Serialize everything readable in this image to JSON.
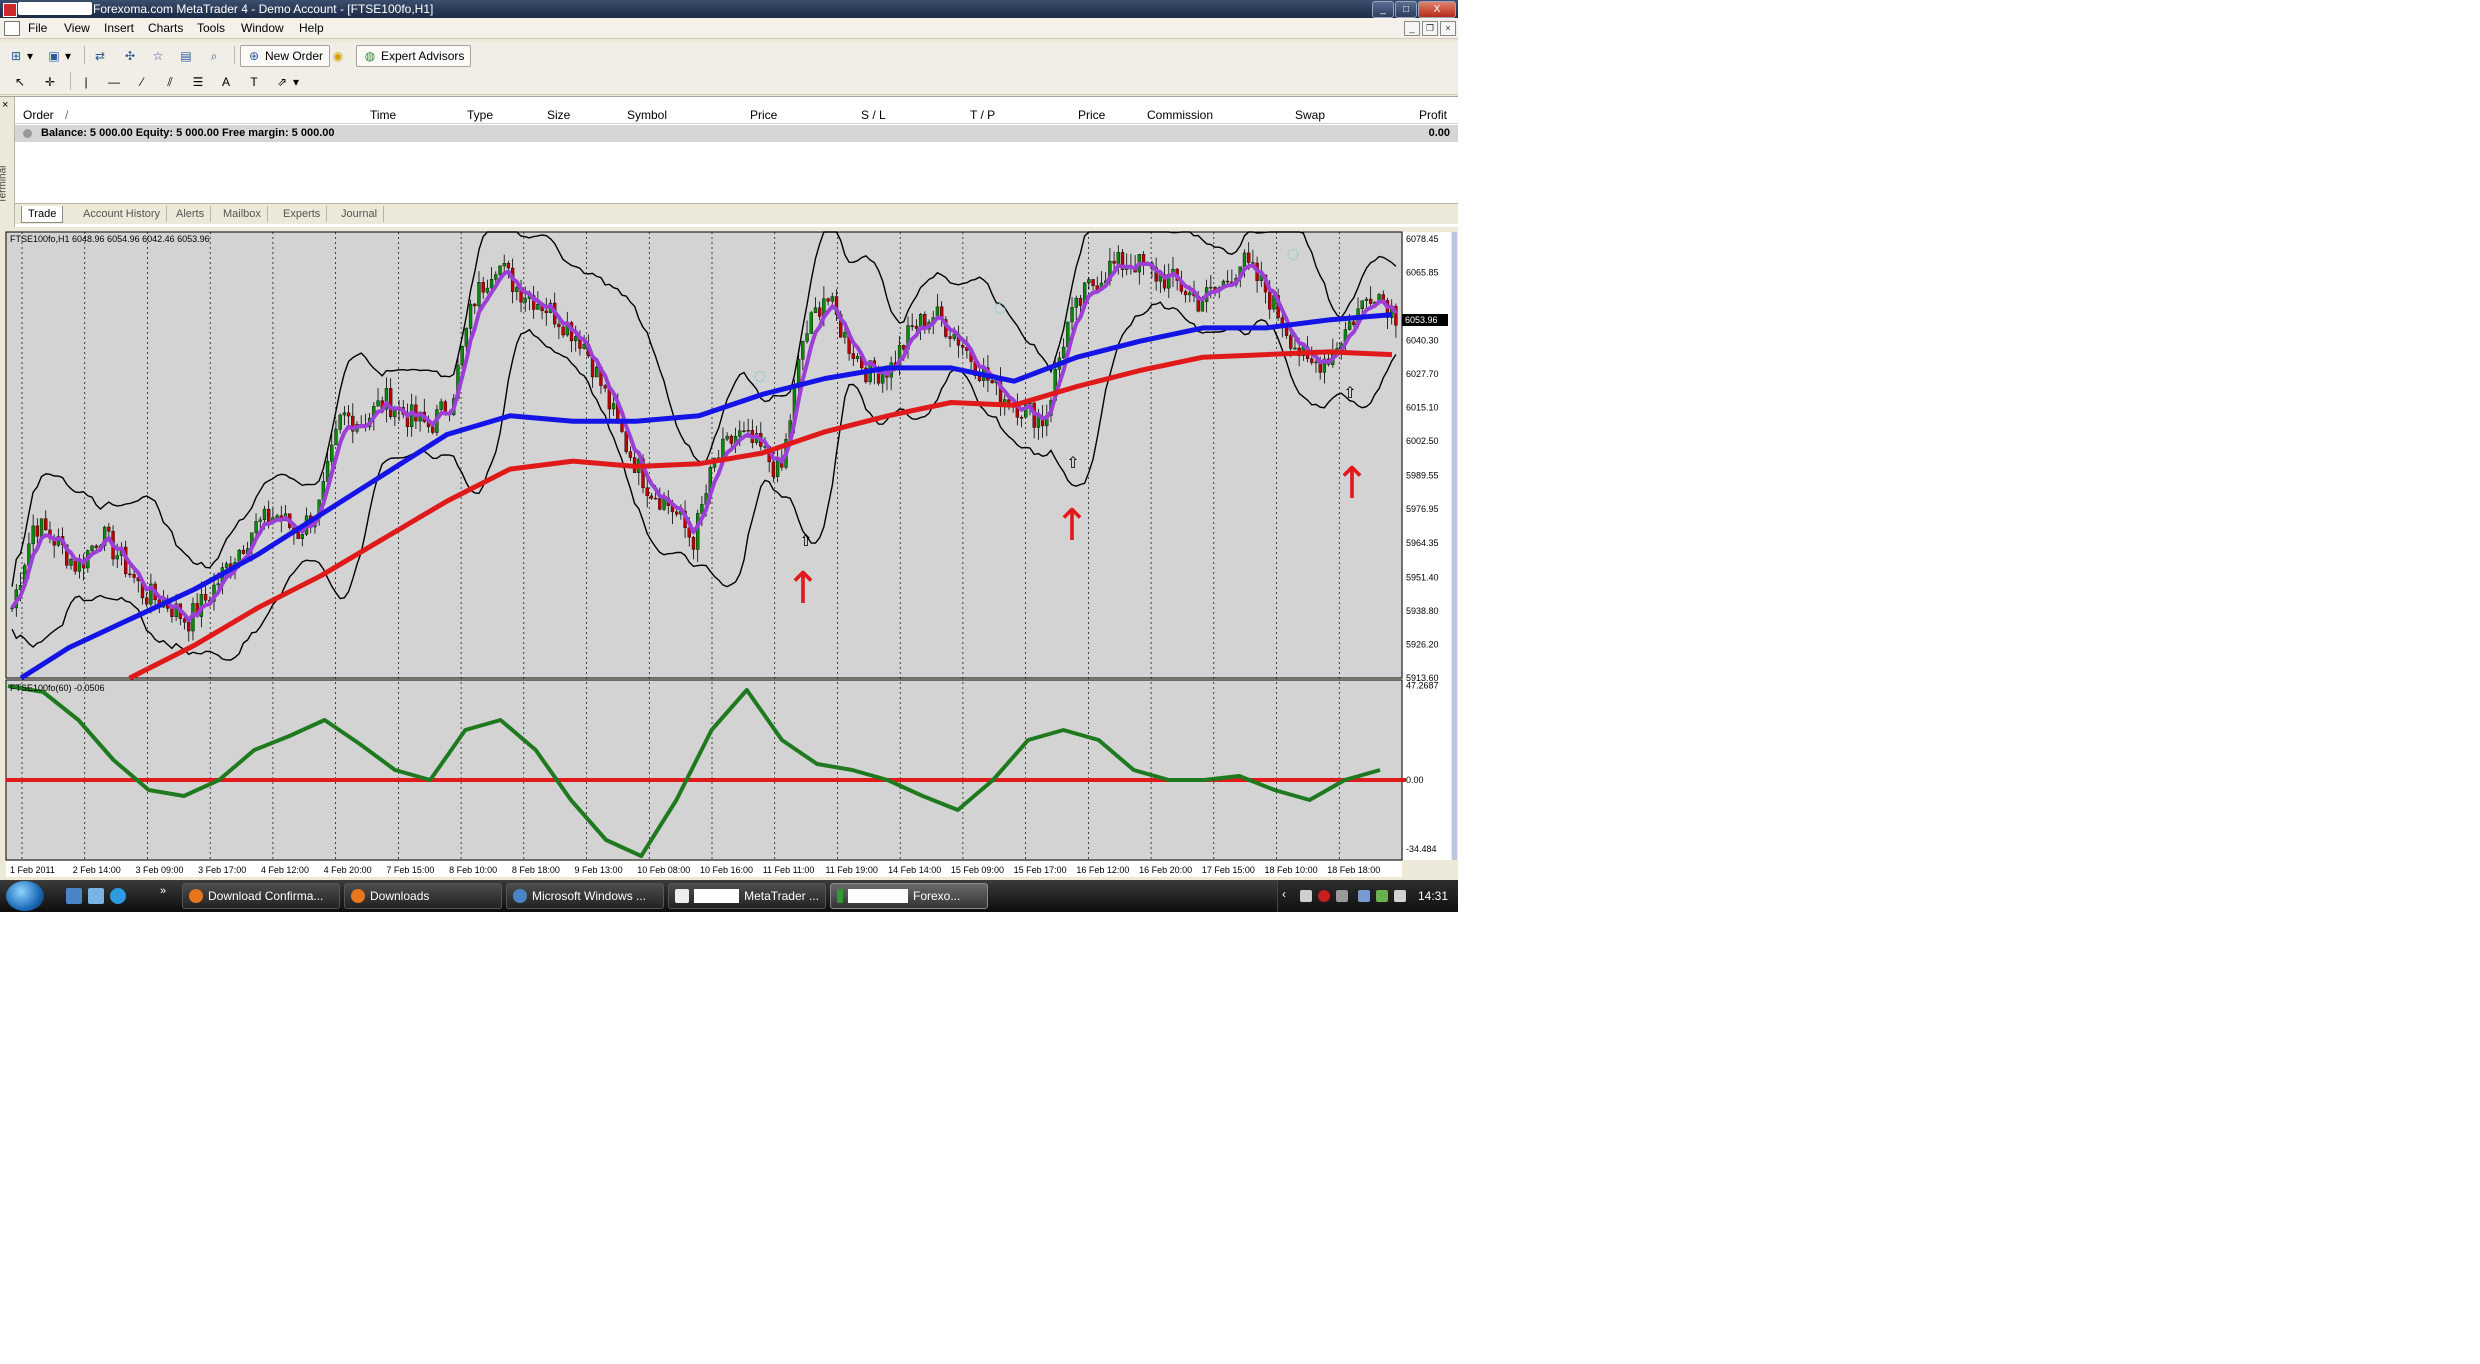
{
  "window": {
    "title": "Forexoma.com MetaTrader 4 - Demo Account - [FTSE100fo,H1]",
    "controls": [
      "_",
      "□",
      "X"
    ]
  },
  "menu": [
    "File",
    "View",
    "Insert",
    "Charts",
    "Tools",
    "Window",
    "Help"
  ],
  "toolbar": {
    "new_order": "New Order",
    "expert_advisors": "Expert Advisors"
  },
  "terminal": {
    "side_label": "Terminal",
    "close": "×",
    "columns": [
      "Order",
      "/",
      "Time",
      "Type",
      "Size",
      "Symbol",
      "Price",
      "S / L",
      "T / P",
      "Price",
      "Commission",
      "Swap",
      "Profit"
    ],
    "balance_row": "Balance: 5 000.00  Equity: 5 000.00  Free margin: 5 000.00",
    "balance_profit": "0.00",
    "tabs": [
      "Trade",
      "Account History",
      "Alerts",
      "Mailbox",
      "Experts",
      "Journal"
    ]
  },
  "chart_data": {
    "type": "candlestick",
    "header": "FTSE100fo,H1  6048.96 6054.96 6042.46 6053.96",
    "current_price": "6053.96",
    "y_ticks": [
      "6078.45",
      "6065.85",
      "6053.96",
      "6040.30",
      "6027.70",
      "6015.10",
      "6002.50",
      "5989.55",
      "5976.95",
      "5964.35",
      "5951.40",
      "5938.80",
      "5926.20",
      "5913.60"
    ],
    "ylim": [
      5913.6,
      6081
    ],
    "x_ticks": [
      "1 Feb 2011",
      "2 Feb 14:00",
      "3 Feb 09:00",
      "3 Feb 17:00",
      "4 Feb 12:00",
      "4 Feb 20:00",
      "7 Feb 15:00",
      "8 Feb 10:00",
      "8 Feb 18:00",
      "9 Feb 13:00",
      "10 Feb 08:00",
      "10 Feb 16:00",
      "11 Feb 11:00",
      "11 Feb 19:00",
      "14 Feb 14:00",
      "15 Feb 09:00",
      "15 Feb 17:00",
      "16 Feb 12:00",
      "16 Feb 20:00",
      "17 Feb 15:00",
      "18 Feb 10:00",
      "18 Feb 18:00"
    ],
    "price_path": [
      5940,
      5972,
      5965,
      5955,
      5968,
      5958,
      5945,
      5942,
      5935,
      5945,
      5958,
      5970,
      5975,
      5968,
      5978,
      6012,
      6010,
      6018,
      6012,
      6008,
      6018,
      6055,
      6070,
      6060,
      6055,
      6048,
      6040,
      6020,
      6000,
      5985,
      5978,
      5965,
      5995,
      6005,
      6000,
      5990,
      6040,
      6058,
      6040,
      6028,
      6030,
      6045,
      6050,
      6042,
      6030,
      6020,
      6015,
      6010,
      6045,
      6060,
      6068,
      6070,
      6065,
      6062,
      6055,
      6060,
      6070,
      6060,
      6045,
      6030,
      6035,
      6048,
      6060,
      6050
    ],
    "series": [
      {
        "name": "",
        "color": "#1414e6",
        "values": [
          5910,
          5925,
          5936,
          5947,
          5960,
          5975,
          5990,
          6005,
          6012,
          6010,
          6010,
          6012,
          6020,
          6026,
          6030,
          6030,
          6025,
          6034,
          6040,
          6045,
          6045,
          6048,
          6050
        ]
      },
      {
        "name": "",
        "color": "#e01a1a",
        "values": [
          5895,
          5904,
          5914,
          5926,
          5940,
          5952,
          5966,
          5980,
          5992,
          5995,
          5993,
          5994,
          5998,
          6006,
          6012,
          6017,
          6016,
          6023,
          6029,
          6034,
          6035,
          6036,
          6035
        ]
      }
    ],
    "indicator": {
      "label": "FTSE100fo(60)  -0.0506",
      "y_ticks": [
        "47.2687",
        "0.00",
        "-34.484"
      ],
      "ylim": [
        -40,
        50
      ],
      "values": [
        47,
        44,
        30,
        10,
        -5,
        -8,
        0,
        15,
        22,
        30,
        18,
        5,
        0,
        25,
        30,
        15,
        -10,
        -30,
        -38,
        -10,
        25,
        45,
        20,
        8,
        5,
        0,
        -8,
        -15,
        0,
        20,
        25,
        20,
        5,
        0,
        0,
        2,
        -5,
        -10,
        0,
        5
      ]
    },
    "arrows": [
      "↑",
      "↑",
      "↑"
    ]
  },
  "taskbar": {
    "tasks": [
      "Download Confirma...",
      "Downloads",
      "Microsoft Windows ...",
      "MetaTrader ...",
      "Forexo..."
    ],
    "clock": "14:31"
  }
}
